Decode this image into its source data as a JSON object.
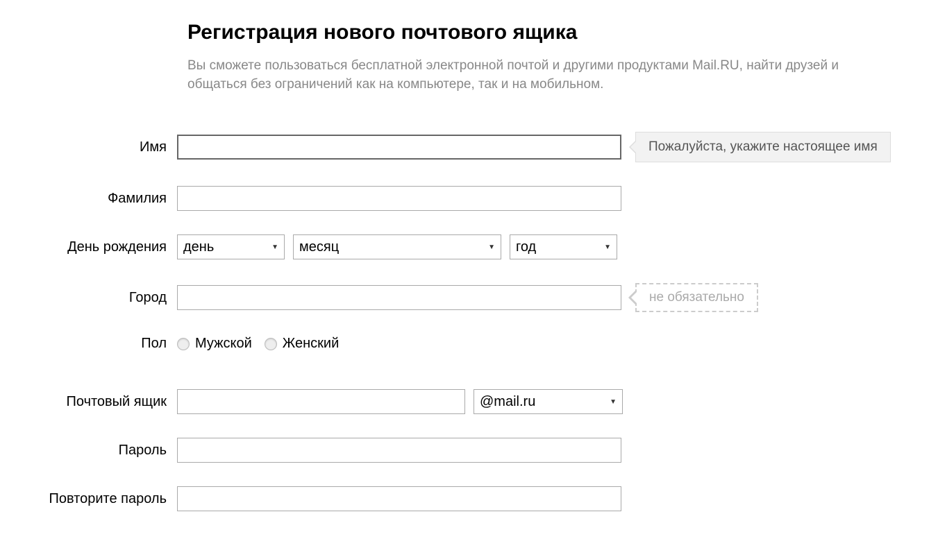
{
  "header": {
    "title": "Регистрация нового почтового ящика",
    "subtitle": "Вы сможете пользоваться бесплатной электронной почтой и другими продуктами Mail.RU, найти друзей и общаться без ограничений как на компьютере, так и на мобильном."
  },
  "labels": {
    "first_name": "Имя",
    "last_name": "Фамилия",
    "birthday": "День рождения",
    "city": "Город",
    "gender": "Пол",
    "mailbox": "Почтовый ящик",
    "password": "Пароль",
    "confirm_password": "Повторите пароль"
  },
  "birthday": {
    "day": "день",
    "month": "месяц",
    "year": "год"
  },
  "gender": {
    "male": "Мужской",
    "female": "Женский"
  },
  "mailbox": {
    "domain": "@mail.ru"
  },
  "tooltips": {
    "real_name": "Пожалуйста, укажите настоящее имя",
    "optional": "не обязательно"
  }
}
